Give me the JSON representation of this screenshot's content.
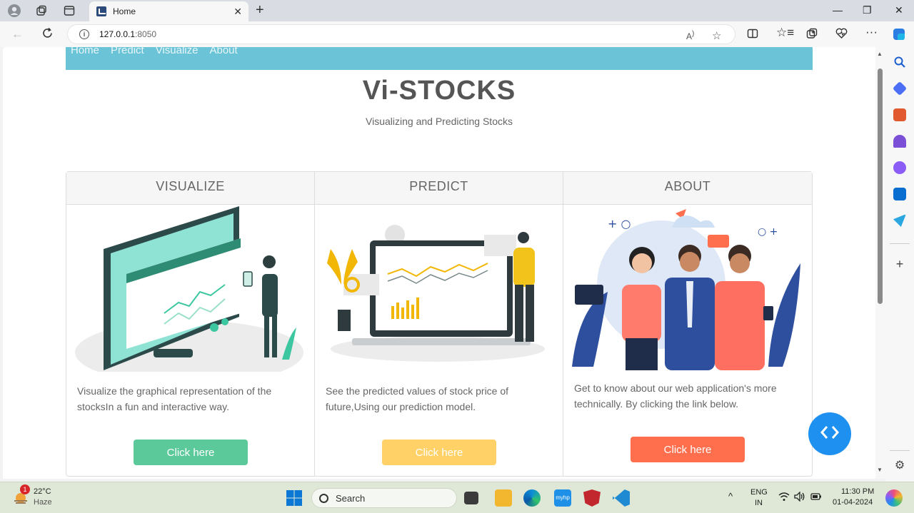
{
  "browser": {
    "tab_title": "Home",
    "tab_close": "✕",
    "new_tab": "+",
    "url_host": "127.0.0.1",
    "url_port": ":8050",
    "win_min": "—",
    "win_max": "❐",
    "win_close": "✕"
  },
  "site": {
    "nav": [
      "Home",
      "Predict",
      "Visualize",
      "About"
    ],
    "title": "Vi-STOCKS",
    "subtitle": "Visualizing and Predicting Stocks"
  },
  "cards": [
    {
      "heading": "VISUALIZE",
      "text": "Visualize the graphical representation of the stocksIn a fun and interactive way.",
      "button": "Click here",
      "color": "#5cc99a"
    },
    {
      "heading": "PREDICT",
      "text": "See the predicted values of stock price of future,Using our prediction model.",
      "button": "Click here",
      "color": "#ffd166"
    },
    {
      "heading": "ABOUT",
      "text": "Get to know about our web application's more technically. By clicking the link below.",
      "button": "Click here",
      "color": "#ff6f4e"
    }
  ],
  "fab": {
    "label": "‹›",
    "color": "#1e90f0"
  },
  "taskbar": {
    "weather_temp": "22°C",
    "weather_desc": "Haze",
    "weather_badge": "1",
    "search_placeholder": "Search",
    "lang_top": "ENG",
    "lang_bottom": "IN",
    "time": "11:30 PM",
    "date": "01-04-2024"
  },
  "icons": [
    "profile-icon",
    "workspaces-icon",
    "tab-actions-icon",
    "back-icon",
    "refresh-icon",
    "info-icon",
    "read-aloud-icon",
    "favorite-star-icon",
    "split-screen-icon",
    "favorites-icon",
    "collections-icon",
    "browser-essentials-icon",
    "more-icon",
    "copilot-icon",
    "search-icon",
    "settings-icon",
    "windows-start-icon",
    "chevron-up-icon",
    "wifi-icon",
    "volume-icon",
    "battery-icon"
  ]
}
